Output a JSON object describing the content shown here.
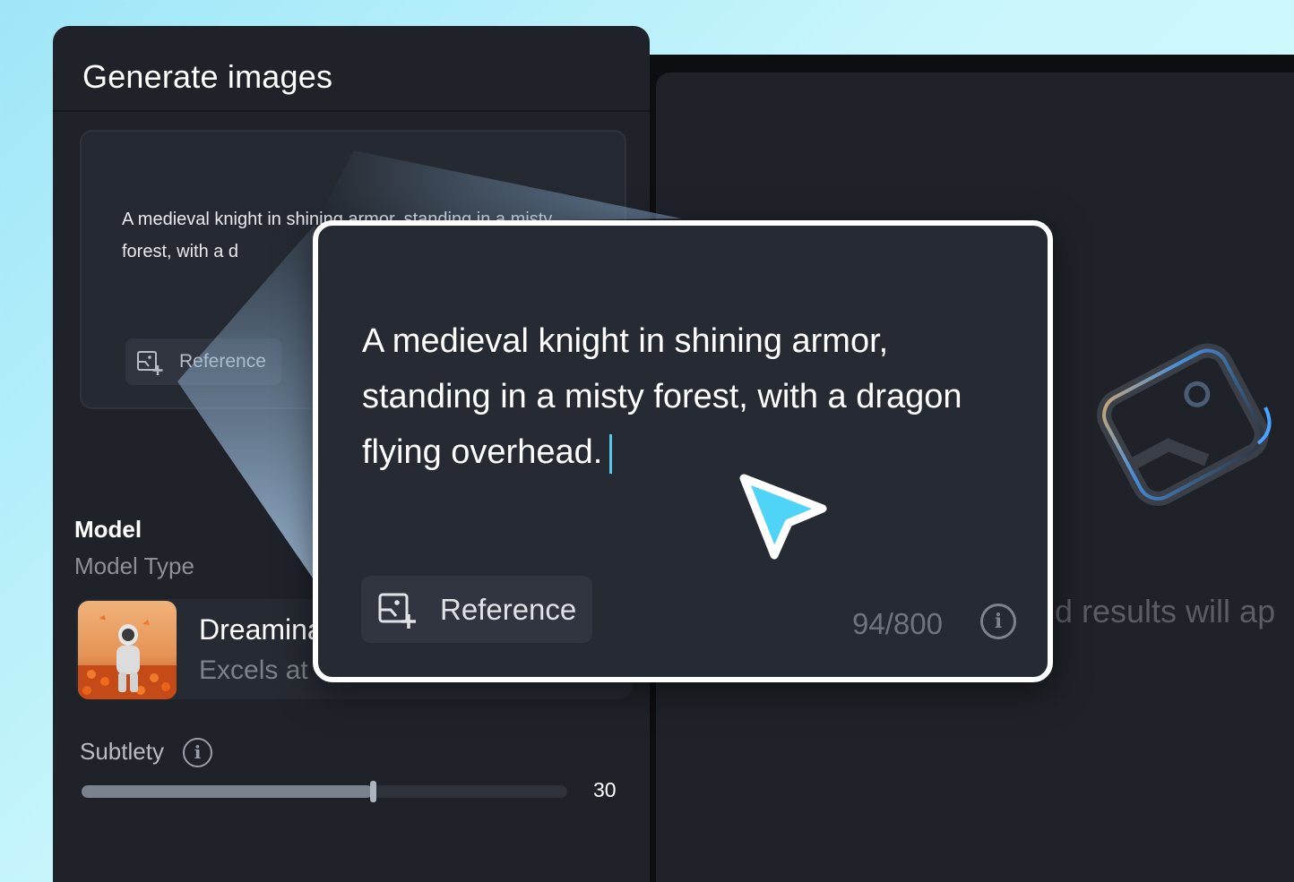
{
  "panel": {
    "title": "Generate images"
  },
  "prompt": {
    "text": "A medieval knight in shining armor, standing in a misty forest, with a dragon flying overhead.",
    "small_text": "A medieval knight in shining armor, standing in a misty forest, with a d",
    "reference_label": "Reference",
    "char_count": "94/800"
  },
  "model": {
    "heading": "Model",
    "type_label": "Model Type",
    "name": "Dreamina",
    "description": "Excels at"
  },
  "subtlety": {
    "label": "Subtlety",
    "value": "30",
    "fraction": 0.6
  },
  "results": {
    "placeholder": "d results will ap"
  },
  "colors": {
    "accent": "#56c8f0",
    "panel_bg": "#1f2229",
    "card_bg": "#262a33"
  }
}
